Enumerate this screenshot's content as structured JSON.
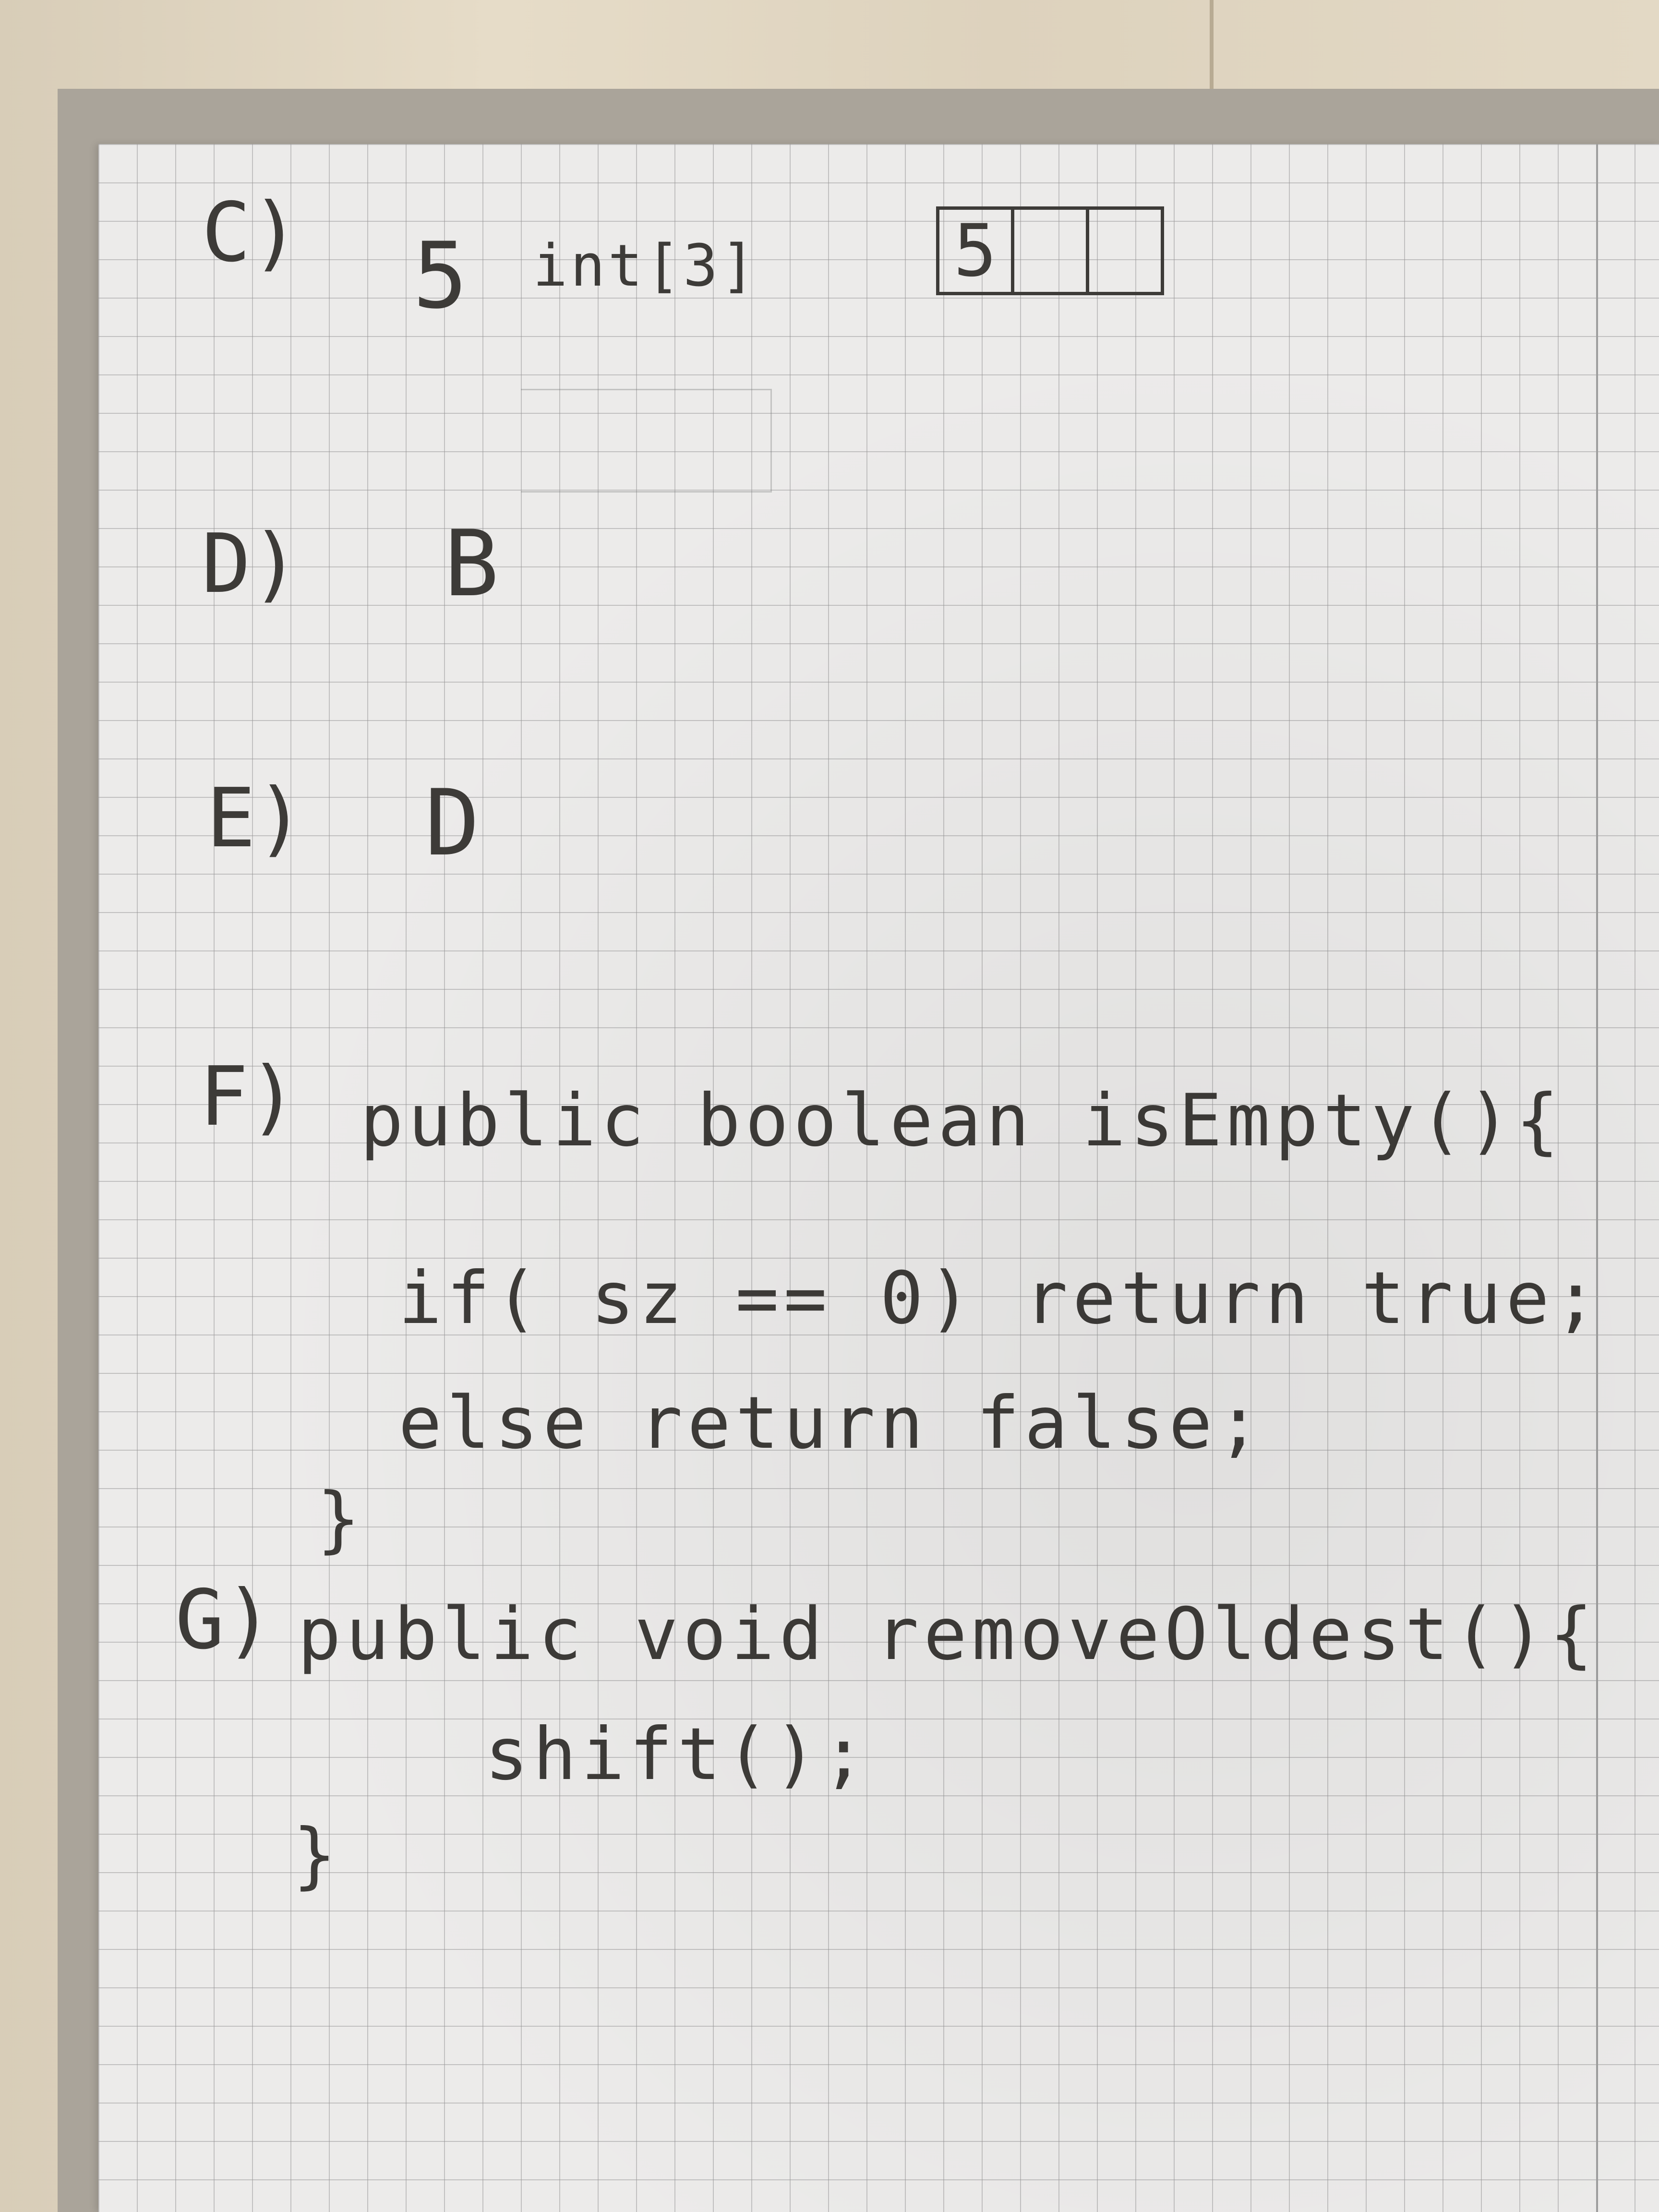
{
  "page": {
    "c_label": "C)",
    "c_value": "5",
    "c_type": "int[3]",
    "c_cells": [
      "5",
      "",
      ""
    ],
    "d_label": "D)",
    "d_answer": "B",
    "e_label": "E)",
    "e_answer": "D",
    "f_label": "F)",
    "f_lines": [
      "public boolean isEmpty(){",
      "if( sz == 0) return true;",
      "else return false;",
      "}"
    ],
    "g_label": "G)",
    "g_lines": [
      "public void removeOldest(){",
      "shift();",
      "}"
    ]
  }
}
